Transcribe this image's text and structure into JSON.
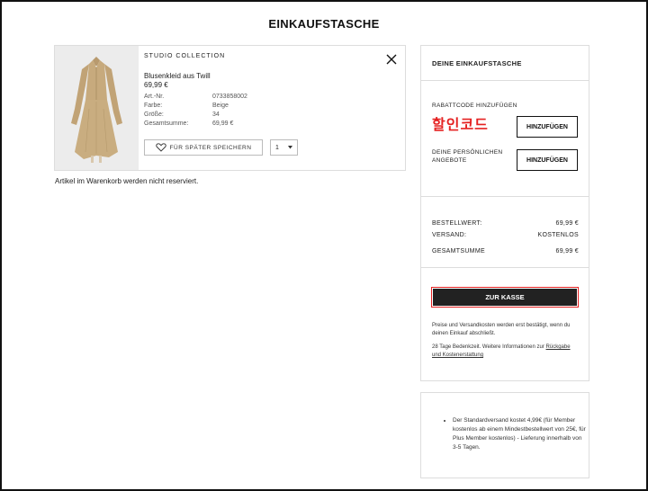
{
  "page": {
    "title": "EINKAUFSTASCHE"
  },
  "item": {
    "brand": "STUDIO COLLECTION",
    "name": "Blusenkleid aus Twill",
    "price": "69,99 €",
    "details": [
      {
        "key": "Art.-Nr.",
        "value": "0733858002"
      },
      {
        "key": "Farbe:",
        "value": "Beige"
      },
      {
        "key": "Größe:",
        "value": "34"
      },
      {
        "key": "Gesamtsumme:",
        "value": "69,99 €"
      }
    ],
    "save_label": "FÜR SPÄTER SPEICHERN",
    "quantity": "1",
    "icons": {
      "close": "close-icon",
      "heart": "heart-icon",
      "chevron": "chevron-down-icon"
    }
  },
  "cart_note": "Artikel im Warenkorb werden nicht reserviert.",
  "summary": {
    "title": "DEINE EINKAUFSTASCHE",
    "promo_label": "RABATTCODE HINZUFÜGEN",
    "coupon_overlay": "할인코드",
    "add_label": "HINZUFÜGEN",
    "offers_label": "DEINE PERSÖNLICHEN ANGEBOTE",
    "rows": [
      {
        "label": "BESTELLWERT:",
        "value": "69,99 €"
      },
      {
        "label": "VERSAND:",
        "value": "KOSTENLOS"
      },
      {
        "label": "GESAMTSUMME",
        "value": "69,99 €"
      }
    ],
    "checkout_label": "ZUR KASSE",
    "note1": "Preise und Versandkosten werden erst bestätigt, wenn du deinen Einkauf abschließt.",
    "note2_text": "28 Tage Bedenkzeit. Weitere Informationen zur",
    "note2_link": "Rückgabe und Kostenerstattung"
  },
  "info": {
    "bullet": "Der Standardversand kostet 4,99€ (für Member kostenlos ab einem Mindestbestellwert von 25€, für Plus Member kostenlos) - Lieferung innerhalb von 3-5 Tagen."
  },
  "colors": {
    "accent_red": "#e52222",
    "button_dark": "#222222",
    "border": "#dddddd"
  }
}
